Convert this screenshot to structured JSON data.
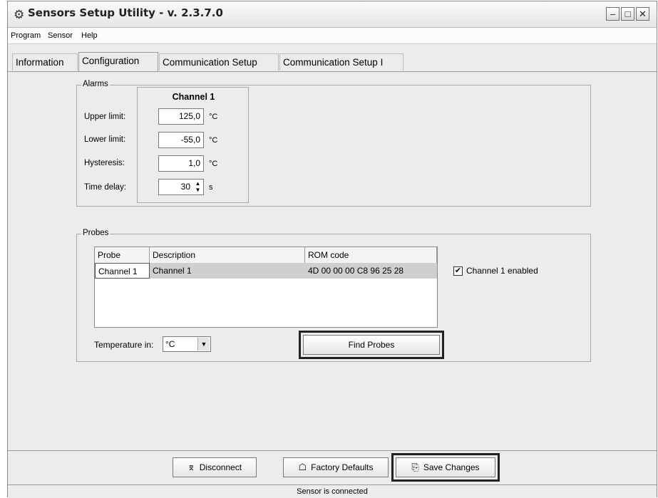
{
  "window": {
    "title": "Sensors Setup Utility - v. 2.3.7.0",
    "app_icon": "sensor-app-icon",
    "controls": [
      "minimize-icon",
      "maximize-icon",
      "close-icon"
    ]
  },
  "menu": [
    "Program",
    "Sensor",
    "Help"
  ],
  "tabs": [
    {
      "label": "Information",
      "active": false
    },
    {
      "label": "Configuration",
      "active": true
    },
    {
      "label": "Communication Setup",
      "active": false
    },
    {
      "label": "Communication Setup I",
      "active": false
    }
  ],
  "alarms": {
    "group_title": "Alarms",
    "channel_title": "Channel 1",
    "upper": {
      "label": "Upper limit:",
      "value": "125,0",
      "unit": "°C"
    },
    "lower": {
      "label": "Lower limit:",
      "value": "-55,0",
      "unit": "°C"
    },
    "hysteresis": {
      "label": "Hysteresis:",
      "value": "1,0",
      "unit": "°C"
    },
    "time_delay": {
      "label": "Time delay:",
      "value": "30",
      "unit": "s"
    }
  },
  "probes": {
    "group_title": "Probes",
    "columns": [
      "Probe",
      "Description",
      "ROM code"
    ],
    "rows": [
      {
        "probe": "Channel 1",
        "description": "Channel 1",
        "rom": "4D 00 00 00 C8 96 25 28"
      }
    ],
    "channel_enabled_label": "Channel 1 enabled",
    "channel_enabled_checked": true,
    "temperature_label": "Temperature in:",
    "temperature_unit": "°C",
    "find_probes": "Find Probes"
  },
  "buttons": {
    "disconnect": "Disconnect",
    "factory_defaults": "Factory Defaults",
    "save_changes": "Save Changes"
  },
  "status": "Sensor is connected"
}
